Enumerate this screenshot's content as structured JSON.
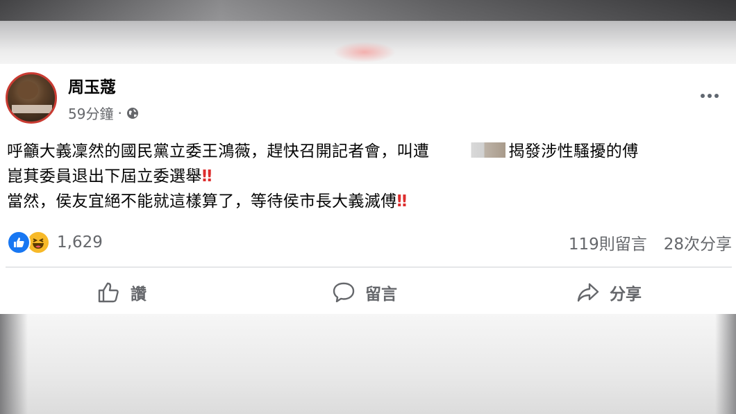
{
  "post": {
    "author": "周玉蔻",
    "time": "59分鐘",
    "separator": "·",
    "privacy_icon": "globe-icon",
    "body": {
      "line1_a": "呼籲大義凜然的國民黨立委王鴻薇，趕快召開記者會，叫遭",
      "line1_b": "揭發涉性騷擾的傅",
      "line2": "崑萁委員退出下屆立委選舉",
      "line3": "當然，侯友宜絕不能就這樣算了，等待侯市長大義滅傅",
      "emphasis": "‼"
    },
    "reactions": {
      "types": [
        "like-icon",
        "haha-icon"
      ],
      "count": "1,629"
    },
    "comments_count": "119則留言",
    "shares_count": "28次分享",
    "actions": {
      "like": "讚",
      "comment": "留言",
      "share": "分享"
    }
  },
  "colors": {
    "like_blue": "#1877f2",
    "haha_yellow": "#f7b928",
    "secondary_text": "#65676b",
    "emphasis_red": "#dd2e2e"
  }
}
